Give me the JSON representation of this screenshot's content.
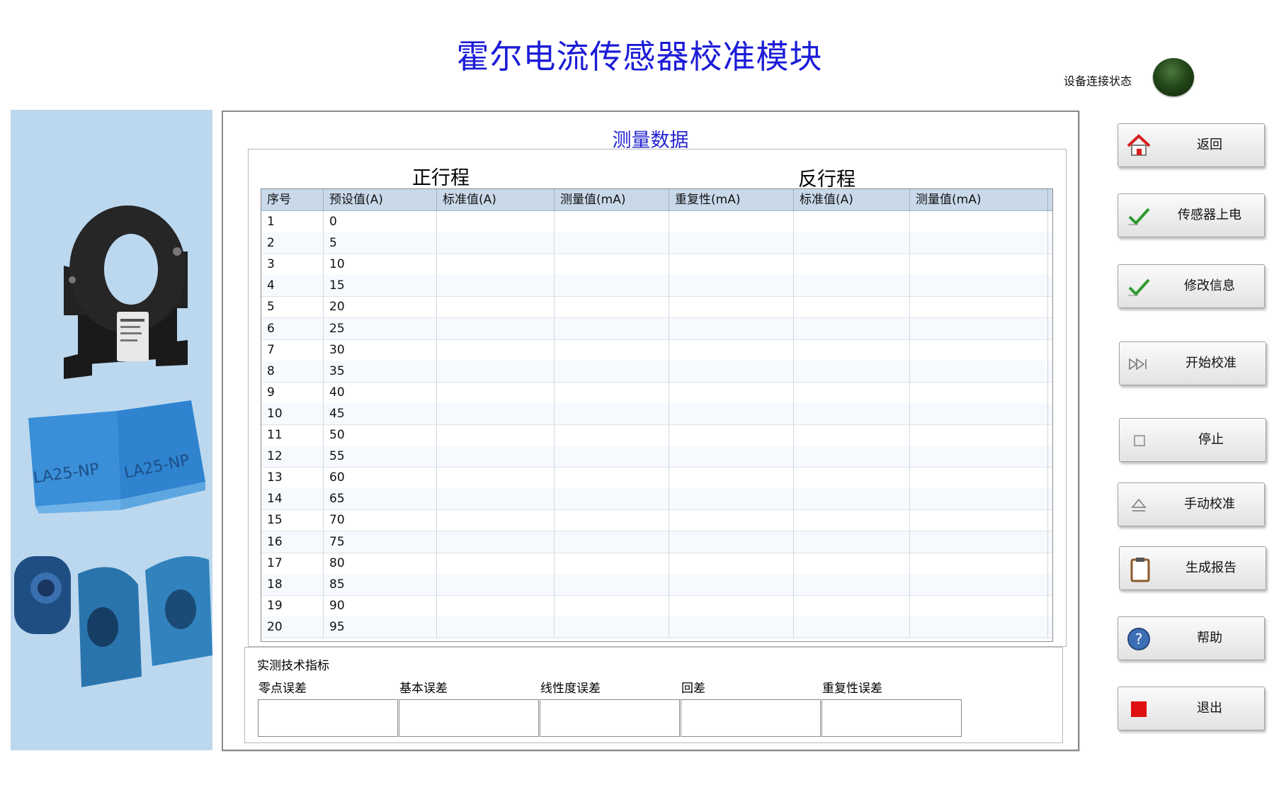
{
  "title": "霍尔电流传感器校准模块",
  "connection": {
    "label": "设备连接状态",
    "led_color": "#2a4a1c"
  },
  "data_section": {
    "title": "测量数据",
    "forward_label": "正行程",
    "reverse_label": "反行程",
    "columns": [
      "序号",
      "预设值(A)",
      "标准值(A)",
      "测量值(mA)",
      "重复性(mA)",
      "标准值(A)",
      "测量值(mA)"
    ],
    "rows": [
      {
        "index": "1",
        "preset": "0"
      },
      {
        "index": "2",
        "preset": "5"
      },
      {
        "index": "3",
        "preset": "10"
      },
      {
        "index": "4",
        "preset": "15"
      },
      {
        "index": "5",
        "preset": "20"
      },
      {
        "index": "6",
        "preset": "25"
      },
      {
        "index": "7",
        "preset": "30"
      },
      {
        "index": "8",
        "preset": "35"
      },
      {
        "index": "9",
        "preset": "40"
      },
      {
        "index": "10",
        "preset": "45"
      },
      {
        "index": "11",
        "preset": "50"
      },
      {
        "index": "12",
        "preset": "55"
      },
      {
        "index": "13",
        "preset": "60"
      },
      {
        "index": "14",
        "preset": "65"
      },
      {
        "index": "15",
        "preset": "70"
      },
      {
        "index": "16",
        "preset": "75"
      },
      {
        "index": "17",
        "preset": "80"
      },
      {
        "index": "18",
        "preset": "85"
      },
      {
        "index": "19",
        "preset": "90"
      },
      {
        "index": "20",
        "preset": "95"
      }
    ]
  },
  "specs": {
    "title": "实测技术指标",
    "items": [
      {
        "label": "零点误差",
        "value": ""
      },
      {
        "label": "基本误差",
        "value": ""
      },
      {
        "label": "线性度误差",
        "value": ""
      },
      {
        "label": "回差",
        "value": ""
      },
      {
        "label": "重复性误差",
        "value": ""
      }
    ]
  },
  "buttons": [
    {
      "label": "返回",
      "icon": "home-icon"
    },
    {
      "label": "传感器上电",
      "icon": "checkmark-icon"
    },
    {
      "label": "修改信息",
      "icon": "checkmark-icon"
    },
    {
      "label": "开始校准",
      "icon": "play-forward-icon"
    },
    {
      "label": "停止",
      "icon": "stop-square-icon"
    },
    {
      "label": "手动校准",
      "icon": "eject-icon"
    },
    {
      "label": "生成报告",
      "icon": "clipboard-icon"
    },
    {
      "label": "帮助",
      "icon": "help-icon"
    },
    {
      "label": "退出",
      "icon": "exit-square-icon"
    }
  ]
}
